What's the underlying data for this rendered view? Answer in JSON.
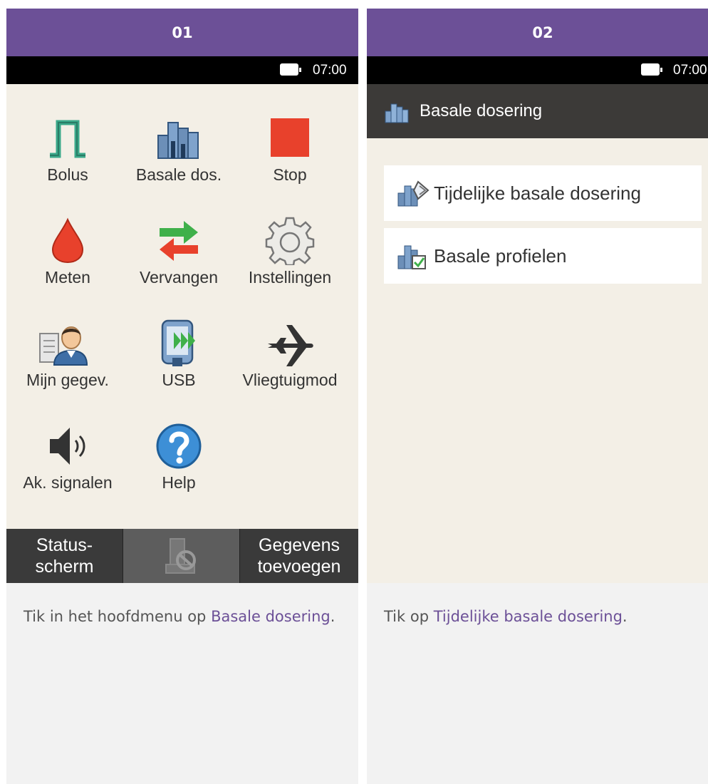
{
  "panels": [
    {
      "step": "01",
      "status": {
        "time": "07:00"
      },
      "menu": [
        {
          "label": "Bolus",
          "icon": "bolus-icon"
        },
        {
          "label": "Basale dos.",
          "icon": "basal-rate-icon"
        },
        {
          "label": "Stop",
          "icon": "stop-icon"
        },
        {
          "label": "Meten",
          "icon": "blood-drop-icon"
        },
        {
          "label": "Vervangen",
          "icon": "swap-arrows-icon"
        },
        {
          "label": "Instellingen",
          "icon": "gear-icon"
        },
        {
          "label": "Mijn gegev.",
          "icon": "my-data-icon"
        },
        {
          "label": "USB",
          "icon": "usb-device-icon"
        },
        {
          "label": "Vliegtuigmod",
          "icon": "airplane-icon"
        },
        {
          "label": "Ak. signalen",
          "icon": "speaker-icon"
        },
        {
          "label": "Help",
          "icon": "help-icon"
        }
      ],
      "bottom": {
        "left": "Status-\nscherm",
        "right": "Gegevens\ntoevoegen",
        "middle_icon": "pump-disconnected-icon"
      },
      "caption": {
        "before": "Tik in het hoofdmenu op ",
        "link": "Basale dosering",
        "after": "."
      }
    },
    {
      "step": "02",
      "status": {
        "time": "07:00"
      },
      "title": "Basale dosering",
      "items": [
        {
          "label": "Tijdelijke basale dosering",
          "icon": "temporary-basal-icon"
        },
        {
          "label": "Basale profielen",
          "icon": "basal-profiles-icon"
        }
      ],
      "caption": {
        "before": "Tik op ",
        "link": "Tijdelijke basale dosering",
        "after": "."
      }
    }
  ],
  "colors": {
    "header": "#6c5097",
    "menu_bg": "#f3efe6",
    "bottom_bar": "#3a3a3a",
    "link": "#6c5097"
  }
}
